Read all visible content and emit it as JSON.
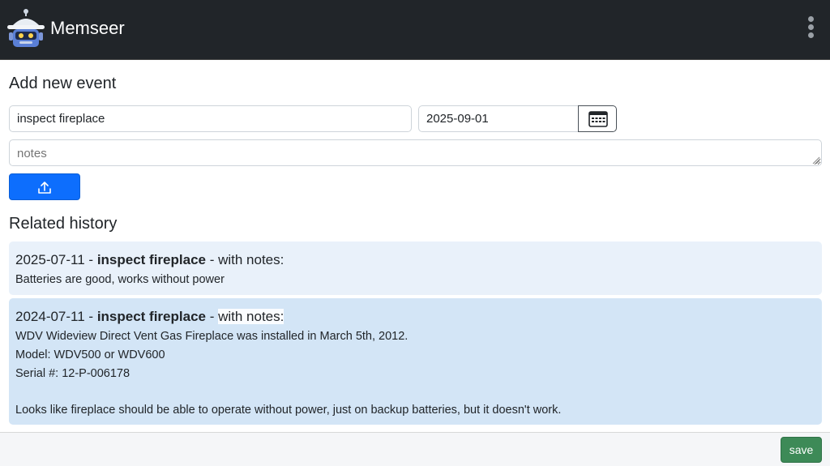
{
  "app": {
    "title": "Memseer"
  },
  "add_event": {
    "heading": "Add new event",
    "title_value": "inspect fireplace",
    "date_value": "2025-09-01",
    "notes_placeholder": "notes"
  },
  "history": {
    "heading": "Related history",
    "entries": [
      {
        "date": "2025-07-11",
        "sep": " - ",
        "title": "inspect fireplace",
        "with_notes": " - with notes:",
        "lines": [
          "Batteries are good, works without power"
        ]
      },
      {
        "date": "2024-07-11",
        "sep": " - ",
        "title": "inspect fireplace",
        "dash": " - ",
        "with_notes": "with notes:",
        "lines": [
          "WDV Wideview Direct Vent Gas Fireplace was installed in March 5th, 2012.",
          "Model: WDV500 or WDV600",
          "Serial #: 12-P-006178",
          "Looks like fireplace should be able to operate without power, just on backup batteries, but it doesn't work."
        ]
      }
    ]
  },
  "footer": {
    "save_label": "save"
  },
  "icons": {
    "logo": "robot-logo-icon",
    "menu": "kebab-menu-icon",
    "calendar": "calendar-icon",
    "upload": "upload-icon"
  },
  "colors": {
    "navbar": "#212529",
    "primary": "#0d6efd",
    "save": "#3d8a57",
    "card_light": "#e9f1fa",
    "card_dark": "#d3e5f6"
  }
}
